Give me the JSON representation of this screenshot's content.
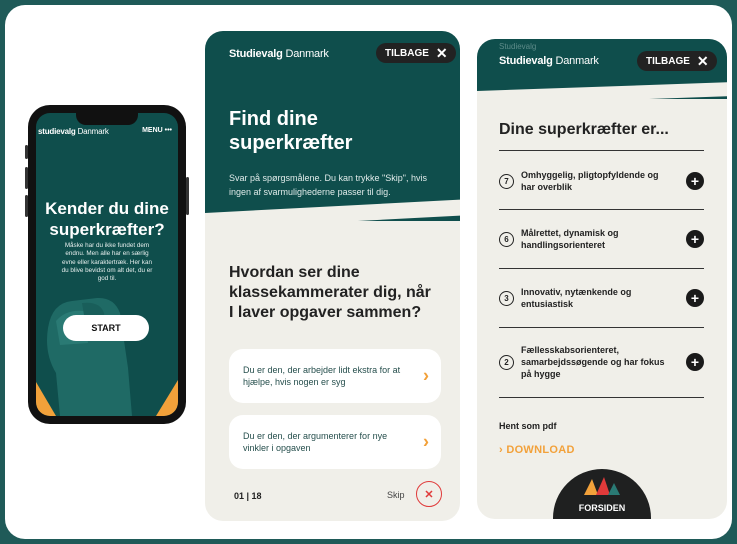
{
  "colors": {
    "teal": "#0f4e4c",
    "orange": "#f2a13a",
    "red": "#e03a3a",
    "cream": "#f0efe9"
  },
  "phone": {
    "brand_bold": "studievalg",
    "brand_thin": "Danmark",
    "menu": "MENU •••",
    "title": "Kender du dine superkræfter?",
    "description": "Måske har du ikke fundet dem endnu. Men alle har en særlig evne eller karaktertræk. Her kan du blive bevidst om alt det, du er god til.",
    "start": "START"
  },
  "quiz": {
    "brand_bold": "Studievalg",
    "brand_thin": "Danmark",
    "back": "TILBAGE",
    "heading": "Find dine superkræfter",
    "subtitle": "Svar på spørgsmålene. Du kan trykke \"Skip\", hvis ingen af svarmulighederne passer til dig.",
    "question": "Hvordan ser dine klassekammerater dig, når I laver opgaver sammen?",
    "options": [
      "Du er den, der arbejder lidt ekstra for at hjælpe, hvis nogen er syg",
      "Du er den, der argumenterer for nye vinkler i opgaven"
    ],
    "counter": "01 | 18",
    "skip": "Skip"
  },
  "results": {
    "ghost_text": "Studievalg",
    "brand_bold": "Studievalg",
    "brand_thin": "Danmark",
    "back": "TILBAGE",
    "title": "Dine superkræfter er...",
    "traits": [
      {
        "num": "7",
        "text": "Omhyggelig, pligtopfyldende og har overblik"
      },
      {
        "num": "6",
        "text": "Målrettet, dynamisk og handlingsorienteret"
      },
      {
        "num": "3",
        "text": "Innovativ, nytænkende og entusiastisk"
      },
      {
        "num": "2",
        "text": "Fællesskabsorienteret, samarbejdssøgende og har fokus på hygge"
      }
    ],
    "pdf_label": "Hent som pdf",
    "download": "DOWNLOAD",
    "home": "FORSIDEN"
  }
}
